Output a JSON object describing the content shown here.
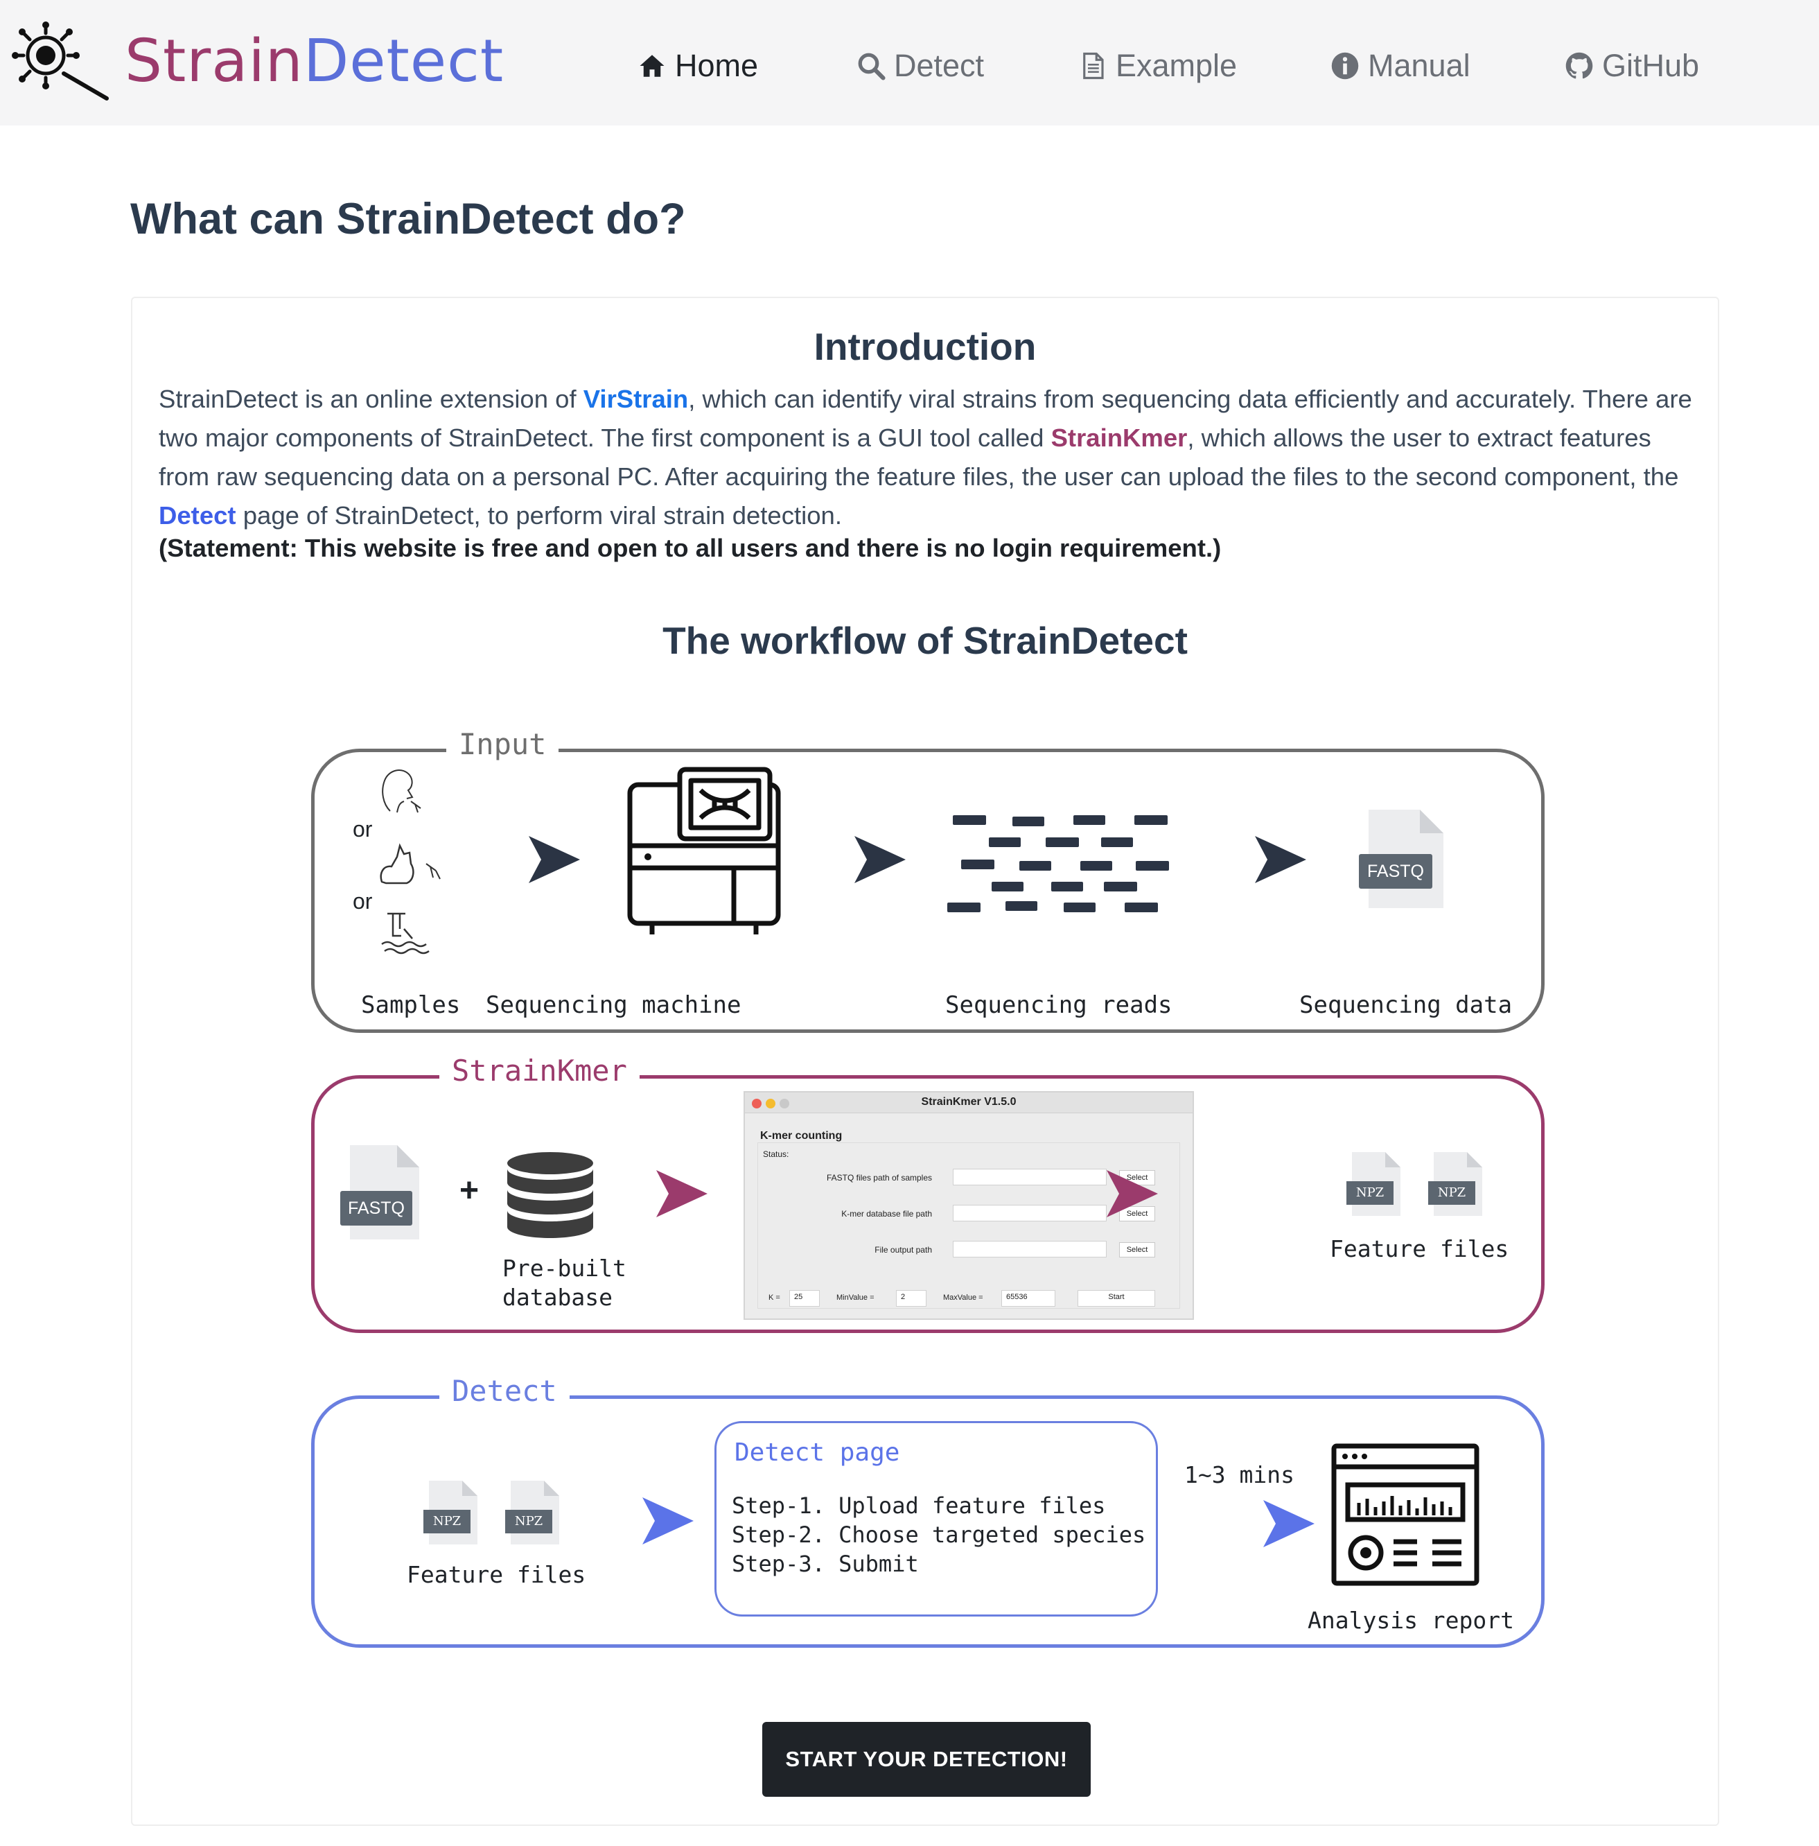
{
  "brand": {
    "part1": "Strain",
    "part2": "Detect"
  },
  "nav": {
    "items": [
      {
        "label": "Home",
        "icon": "home-icon"
      },
      {
        "label": "Detect",
        "icon": "search-icon"
      },
      {
        "label": "Example",
        "icon": "file-icon"
      },
      {
        "label": "Manual",
        "icon": "info-icon"
      },
      {
        "label": "GitHub",
        "icon": "github-icon"
      }
    ]
  },
  "page": {
    "title": "What can StrainDetect do?",
    "intro_heading": "Introduction",
    "intro": {
      "t1": "StrainDetect is an online extension of ",
      "link_virstrain": "VirStrain",
      "t2": ", which can identify viral strains from sequencing data efficiently and accurately. There are two major components of StrainDetect. The first component is a GUI tool called ",
      "link_strainkmer": "StrainKmer",
      "t3": ", which allows the user to extract features from raw sequencing data on a personal PC. After acquiring the feature files, the user can upload the files to the second component, the ",
      "link_detect": "Detect",
      "t4": " page of StrainDetect, to perform viral strain detection."
    },
    "statement": "(Statement: This website is free and open to all users and there is no login requirement.)",
    "workflow_heading": "The workflow of StrainDetect",
    "cta": "START YOUR DETECTION!"
  },
  "workflow": {
    "input": {
      "label": "Input",
      "or1": "or",
      "or2": "or",
      "samples": "Samples",
      "machine": "Sequencing machine",
      "reads": "Sequencing reads",
      "data": "Sequencing data",
      "fastq": "FASTQ"
    },
    "kmer": {
      "label": "StrainKmer",
      "fastq": "FASTQ",
      "plus": "+",
      "db_line1": "Pre-built",
      "db_line2": "database",
      "npz1": "NPZ",
      "npz2": "NPZ",
      "feature_files": "Feature files",
      "gui": {
        "title": "StrainKmer V1.5.0",
        "subtitle": "K-mer counting",
        "status": "Status:",
        "row1": "FASTQ files path of samples",
        "row2": "K-mer database file path",
        "row3": "File output path",
        "select": "Select",
        "k_label": "K =",
        "k_value": "25",
        "min_label": "MinValue =",
        "min_value": "2",
        "max_label": "MaxValue =",
        "max_value": "65536",
        "start": "Start"
      }
    },
    "detect": {
      "label": "Detect",
      "npz1": "NPZ",
      "npz2": "NPZ",
      "feature_files": "Feature files",
      "box_title": "Detect page",
      "step1": "Step-1. Upload feature files",
      "step2": "Step-2. Choose targeted species",
      "step3": "Step-3. Submit",
      "time": "1~3 mins",
      "report": "Analysis report"
    }
  },
  "colors": {
    "brand_purple": "#9b3b6c",
    "brand_blue": "#5b6fd9",
    "input_border": "#6e6e6e",
    "kmer_border": "#9b3b6c",
    "detect_border": "#6a7fe0",
    "arrow_dark": "#2b3444",
    "cta_bg": "#1f2328"
  }
}
